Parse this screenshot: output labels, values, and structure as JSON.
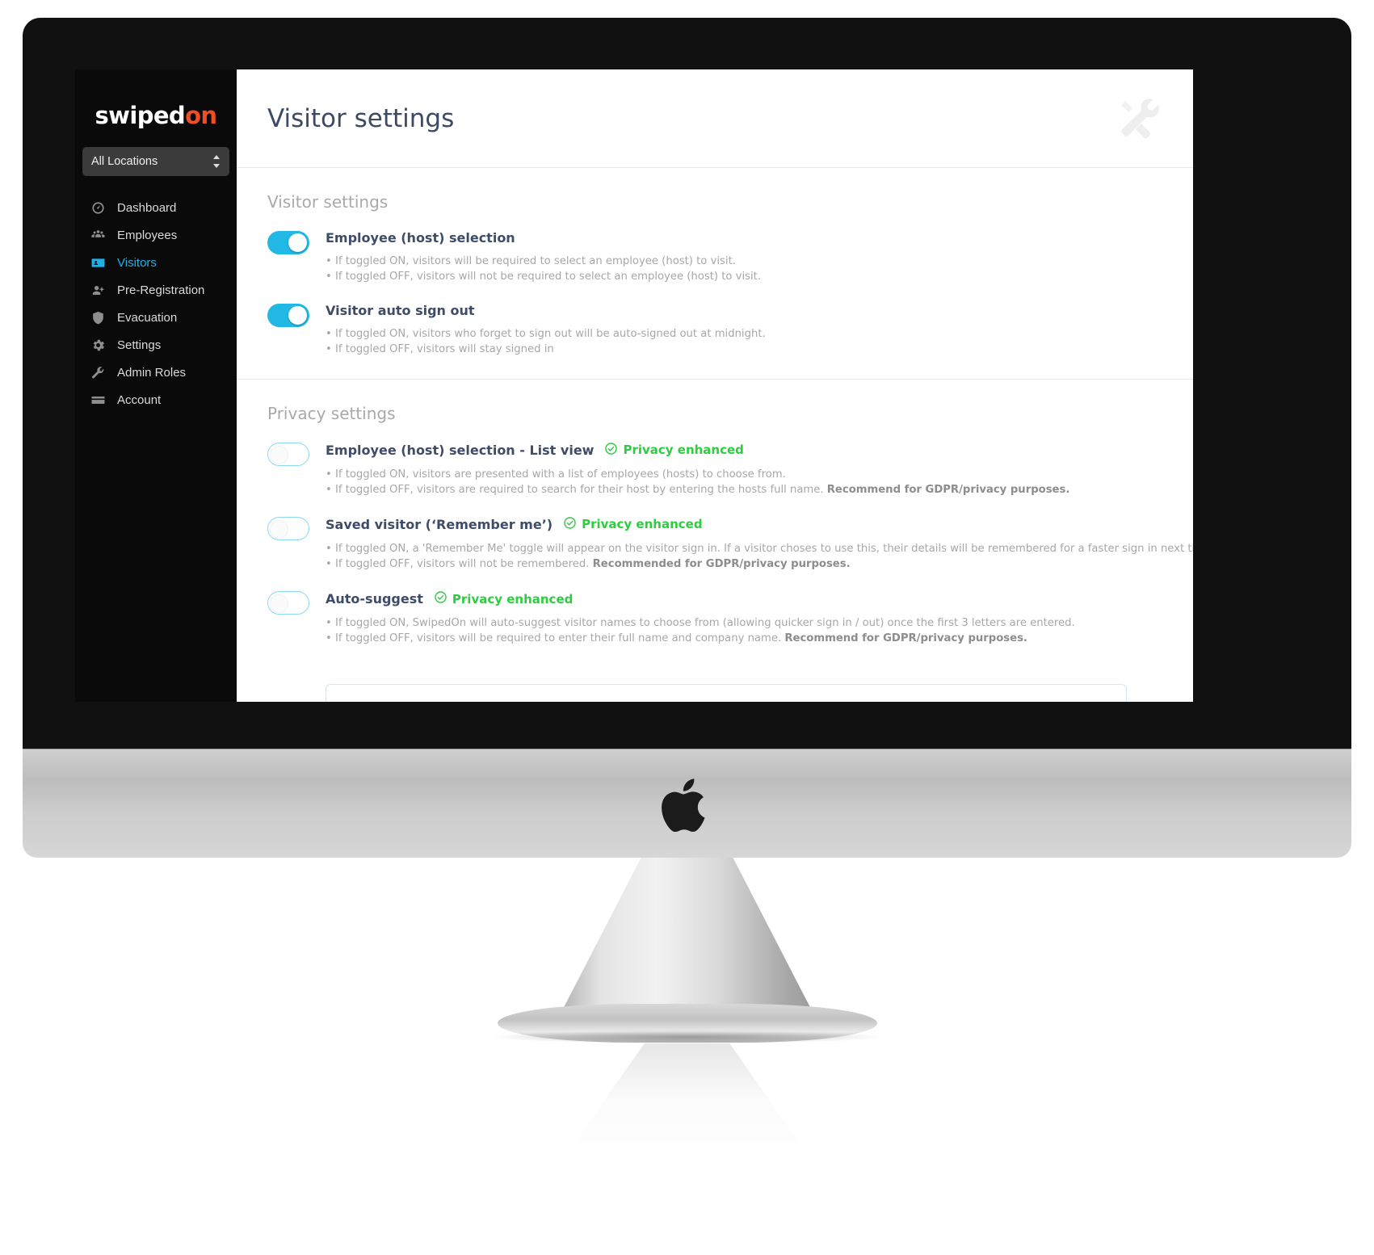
{
  "brand": {
    "name_first": "swiped",
    "name_accent": "on"
  },
  "sidebar": {
    "location_selector": {
      "value": "All Locations",
      "icon": "sort-updown-icon"
    },
    "items": [
      {
        "label": "Dashboard",
        "icon": "dashboard-gauge-icon",
        "active": false
      },
      {
        "label": "Employees",
        "icon": "people-group-icon",
        "active": false
      },
      {
        "label": "Visitors",
        "icon": "id-badge-icon",
        "active": true
      },
      {
        "label": "Pre-Registration",
        "icon": "person-plus-icon",
        "active": false
      },
      {
        "label": "Evacuation",
        "icon": "shield-icon",
        "active": false
      },
      {
        "label": "Settings",
        "icon": "gear-icon",
        "active": false
      },
      {
        "label": "Admin Roles",
        "icon": "wrench-icon",
        "active": false
      },
      {
        "label": "Account",
        "icon": "credit-card-icon",
        "active": false
      }
    ]
  },
  "header": {
    "title": "Visitor settings",
    "tools_icon": "tools-wrench-screwdriver-icon"
  },
  "sections": [
    {
      "title": "Visitor settings",
      "rows": [
        {
          "label": "Employee (host) selection",
          "toggle_state": "on",
          "badge": null,
          "lines": [
            {
              "text": "• If toggled ON, visitors will be required to select an employee (host) to visit.",
              "bold": ""
            },
            {
              "text": "• If toggled OFF, visitors will not be required to select an employee (host) to visit.",
              "bold": ""
            }
          ]
        },
        {
          "label": "Visitor auto sign out",
          "toggle_state": "on",
          "badge": null,
          "lines": [
            {
              "text": "• If toggled ON, visitors who forget to sign out will be auto-signed out at midnight.",
              "bold": ""
            },
            {
              "text": "• If toggled OFF, visitors will stay signed in",
              "bold": ""
            }
          ]
        }
      ]
    },
    {
      "title": "Privacy settings",
      "rows": [
        {
          "label": "Employee (host) selection - List view",
          "toggle_state": "off",
          "badge": {
            "text": "Privacy enhanced",
            "icon": "check-circle-icon",
            "color": "#2ecc40"
          },
          "lines": [
            {
              "text": "• If toggled ON, visitors are presented with a list of employees (hosts) to choose from.",
              "bold": ""
            },
            {
              "text": "• If toggled OFF, visitors are required to search for their host by entering the hosts full name. ",
              "bold": "Recommend for GDPR/privacy purposes."
            }
          ]
        },
        {
          "label": "Saved visitor (‘Remember me’)",
          "toggle_state": "off",
          "badge": {
            "text": "Privacy enhanced",
            "icon": "check-circle-icon",
            "color": "#2ecc40"
          },
          "lines": [
            {
              "text": "• If toggled ON, a 'Remember Me' toggle will appear on the visitor sign in. If a visitor choses to use this, their details will be remembered for a faster sign in next time.",
              "bold": ""
            },
            {
              "text": "• If toggled OFF, visitors will not be remembered. ",
              "bold": "Recommended for GDPR/privacy purposes."
            }
          ]
        },
        {
          "label": "Auto-suggest",
          "toggle_state": "off",
          "badge": {
            "text": "Privacy enhanced",
            "icon": "check-circle-icon",
            "color": "#2ecc40"
          },
          "lines": [
            {
              "text": "• If toggled ON, SwipedOn will auto-suggest visitor names to choose from (allowing quicker sign in / out) once the first 3 letters are entered.",
              "bold": ""
            },
            {
              "text": "• If toggled OFF, visitors will be required to enter their full name and company name. ",
              "bold": "Recommend for GDPR/privacy purposes."
            }
          ]
        }
      ]
    }
  ],
  "colors": {
    "accent_blue": "#22b8e6",
    "brand_orange": "#f04e23",
    "green": "#2ecc40",
    "title_navy": "#3d4a66",
    "sidebar_bg": "#0a0a0a"
  }
}
